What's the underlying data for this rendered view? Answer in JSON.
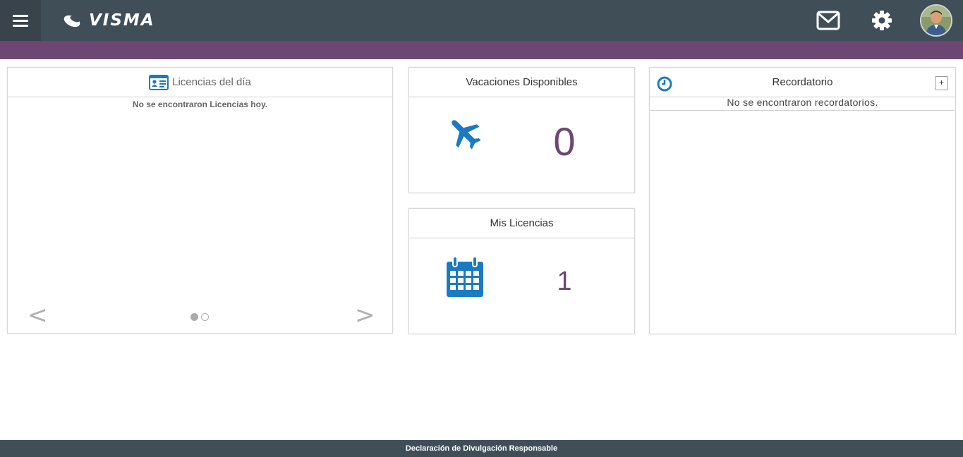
{
  "header": {
    "logo_text": "VISMA",
    "icons": [
      "menu-icon",
      "mail-icon",
      "gear-icon",
      "avatar"
    ]
  },
  "panels": {
    "licencias_dia": {
      "title": "Licencias del día",
      "empty_text": "No se encontraron Licencias hoy.",
      "prev": "<",
      "next": ">"
    },
    "vacaciones": {
      "title": "Vacaciones Disponibles",
      "value": "0"
    },
    "mis_licencias": {
      "title": "Mis Licencias",
      "value": "1"
    },
    "recordatorio": {
      "title": "Recordatorio",
      "add_label": "+",
      "empty_text": "No se encontraron recordatorios."
    }
  },
  "footer": {
    "link": "Declaración de Divulgación Responsable"
  },
  "colors": {
    "topbar": "#404e58",
    "accent_purple": "#6d4673",
    "icon_blue": "#1a7bc4"
  }
}
